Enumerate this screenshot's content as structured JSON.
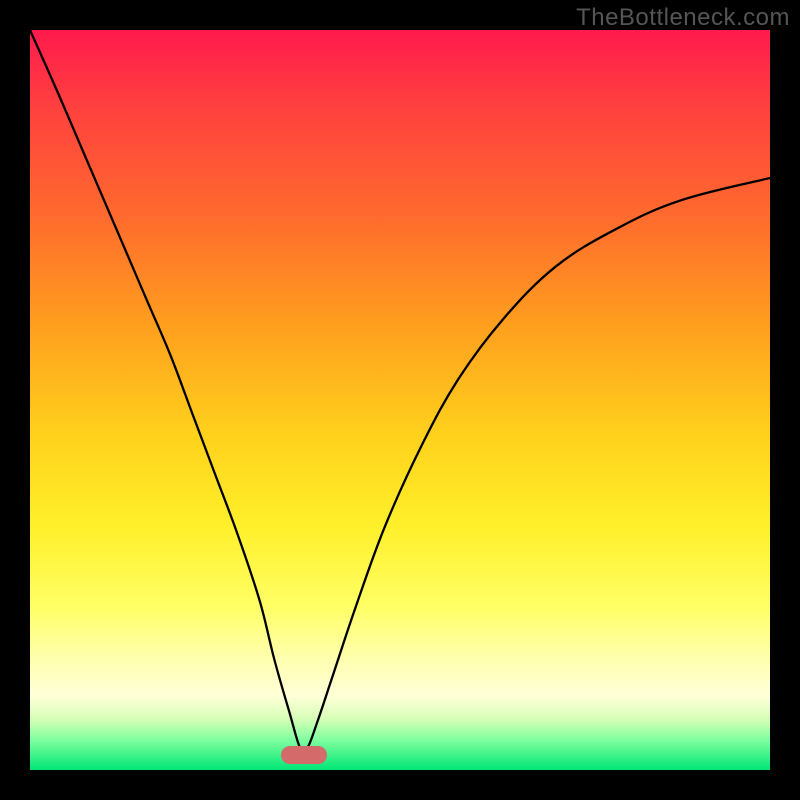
{
  "watermark": "TheBottleneck.com",
  "colors": {
    "frame": "#000000",
    "curve": "#000000",
    "marker": "#d46a6a",
    "gradient_top": "#ff1a4d",
    "gradient_bottom": "#00e676"
  },
  "chart_data": {
    "type": "line",
    "title": "",
    "xlabel": "",
    "ylabel": "",
    "xlim": [
      0,
      100
    ],
    "ylim": [
      0,
      100
    ],
    "grid": false,
    "legend": false,
    "annotations": [
      {
        "kind": "marker-pill",
        "x": 37,
        "y": 2
      }
    ],
    "series": [
      {
        "name": "bottleneck-curve",
        "x": [
          0,
          4,
          7,
          10,
          13,
          16,
          19,
          22,
          25,
          28,
          31,
          33,
          35,
          36.5,
          37.5,
          39,
          41,
          44,
          48,
          53,
          58,
          64,
          71,
          79,
          88,
          100
        ],
        "y": [
          100,
          91,
          84,
          77,
          70,
          63,
          56,
          48,
          40,
          32,
          23,
          15,
          8,
          3,
          3,
          7,
          13,
          22,
          33,
          44,
          53,
          61,
          68,
          73,
          77,
          80
        ]
      }
    ]
  }
}
